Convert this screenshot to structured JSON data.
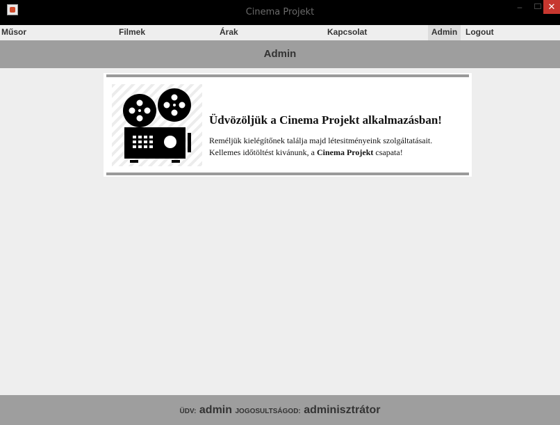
{
  "window": {
    "title": "Cinema Projekt",
    "minimize_glyph": "–",
    "close_glyph": "✕",
    "icon": "java-cup-icon"
  },
  "menu": {
    "items": [
      {
        "label": "Műsor"
      },
      {
        "label": "Filmek"
      },
      {
        "label": "Árak"
      },
      {
        "label": "Kapcsolat"
      },
      {
        "label": "Admin"
      },
      {
        "label": "Logout"
      }
    ]
  },
  "header": {
    "title": "Admin"
  },
  "welcome": {
    "icon": "film-projector-icon",
    "heading": "Üdvözöljük a Cinema Projekt alkalmazásban!",
    "line1": "Reméljük kielégítőnek találja majd létesitményeink szolgáltatásait.",
    "line2_prefix": "Kellemes időtöltést kivánunk, a ",
    "line2_bold": "Cinema Projekt",
    "line2_suffix": " csapata!"
  },
  "footer": {
    "greeting_label": "ÜDV:",
    "username": "admin",
    "role_label": "JOGOSULTSÁGOD:",
    "role": "adminisztrátor"
  },
  "colors": {
    "background": "#eeeeee",
    "header_band": "#9e9e9e",
    "close_button": "#c7372f"
  }
}
